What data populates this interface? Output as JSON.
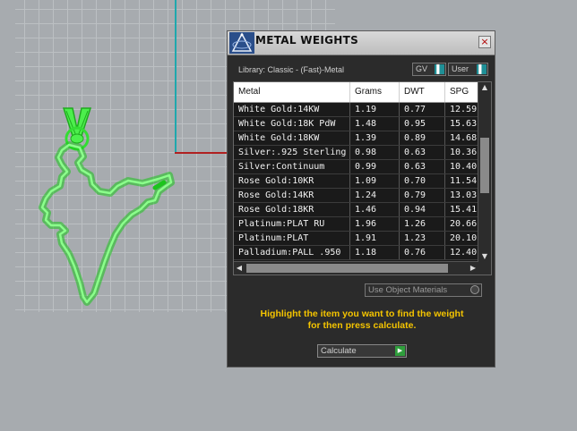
{
  "dialog": {
    "title": "METAL WEIGHTS",
    "close_label": "×",
    "library_label": "Library: Classic - (Fast)-Metal",
    "gv_option": "GV",
    "user_option": "User",
    "use_object_materials_label": "Use Object Materials",
    "hint_line1": "Highlight the item you want to find the weight",
    "hint_line2": "for then press calculate.",
    "calculate_label": "Calculate"
  },
  "table": {
    "headers": [
      "Metal",
      "Grams",
      "DWT",
      "SPG"
    ],
    "rows": [
      [
        "White Gold:14KW",
        "1.19",
        "0.77",
        "12.59"
      ],
      [
        "White Gold:18K PdW",
        "1.48",
        "0.95",
        "15.63"
      ],
      [
        "White Gold:18KW",
        "1.39",
        "0.89",
        "14.68"
      ],
      [
        "Silver:.925 Sterling",
        "0.98",
        "0.63",
        "10.36"
      ],
      [
        "Silver:Continuum",
        "0.99",
        "0.63",
        "10.40"
      ],
      [
        "Rose Gold:10KR",
        "1.09",
        "0.70",
        "11.54"
      ],
      [
        "Rose Gold:14KR",
        "1.24",
        "0.79",
        "13.03"
      ],
      [
        "Rose Gold:18KR",
        "1.46",
        "0.94",
        "15.41"
      ],
      [
        "Platinum:PLAT RU",
        "1.96",
        "1.26",
        "20.66"
      ],
      [
        "Platinum:PLAT",
        "1.91",
        "1.23",
        "20.10"
      ],
      [
        "Palladium:PALL .950",
        "1.18",
        "0.76",
        "12.40"
      ]
    ]
  },
  "colors": {
    "hint": "#f4c400",
    "model_green": "#33dd33",
    "axis_y": "#1fa8ad",
    "axis_x": "#b02020"
  },
  "icons": {
    "logo": "tripod-logo-icon",
    "close": "close-icon",
    "scroll_up": "chevron-up-icon",
    "scroll_down": "chevron-down-icon",
    "scroll_left": "chevron-left-icon",
    "scroll_right": "chevron-right-icon",
    "calculate": "play-icon"
  }
}
